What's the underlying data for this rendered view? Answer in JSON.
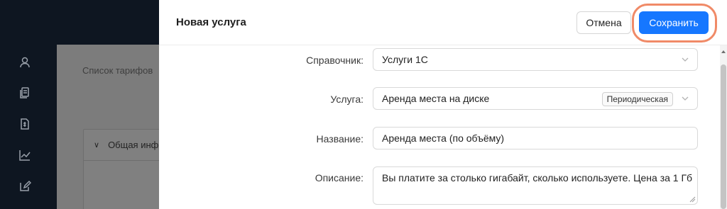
{
  "background": {
    "page_title": "Список тарифов",
    "card_header": "Общая инфо"
  },
  "sidebar": {
    "icons": [
      "user-icon",
      "documents-icon",
      "invoice-icon",
      "chart-icon",
      "edit-icon"
    ]
  },
  "drawer": {
    "title": "Новая услуга",
    "cancel_label": "Отмена",
    "save_label": "Сохранить"
  },
  "form": {
    "catalog": {
      "label": "Справочник:",
      "value": "Услуги 1С"
    },
    "service": {
      "label": "Услуга:",
      "value": "Аренда места на диске",
      "tag": "Периодическая"
    },
    "name": {
      "label": "Название:",
      "value": "Аренда места (по объёму)"
    },
    "description": {
      "label": "Описание:",
      "value": "Вы платите за столько гигабайт, сколько используете. Цена за 1 Гб"
    }
  },
  "colors": {
    "accent": "#1677ff",
    "highlight": "#f08a67",
    "chrome": "#0e1621"
  }
}
